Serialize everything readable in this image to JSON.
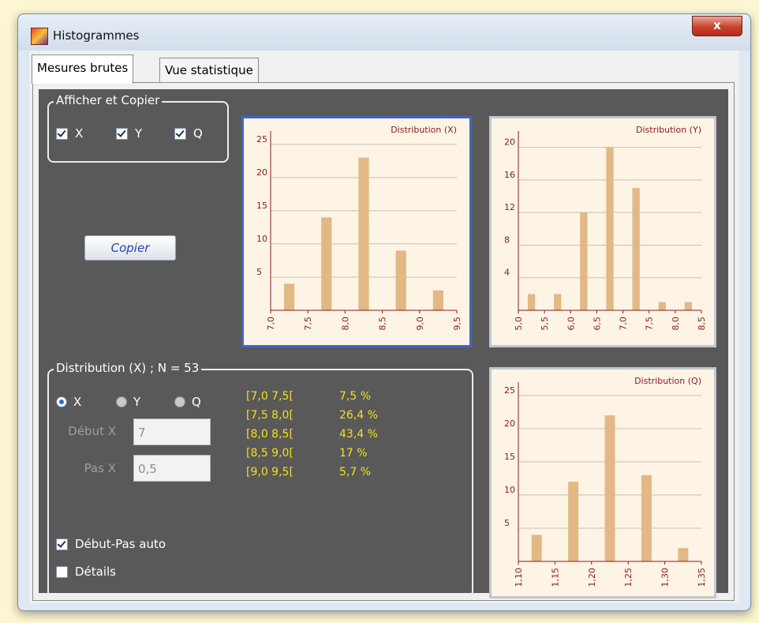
{
  "window": {
    "title": "Histogrammes",
    "close_glyph": "x"
  },
  "tabs": [
    {
      "label": "Mesures brutes"
    },
    {
      "label": "Vue statistique"
    }
  ],
  "display_group": {
    "title": "Afficher et Copier",
    "checkboxes": [
      {
        "label": "X",
        "checked": true
      },
      {
        "label": "Y",
        "checked": true
      },
      {
        "label": "Q",
        "checked": true
      }
    ],
    "copy_button": "Copier"
  },
  "distribution_group": {
    "title": "Distribution (X) ; N = 53",
    "radios": [
      {
        "label": "X",
        "selected": true
      },
      {
        "label": "Y",
        "selected": false
      },
      {
        "label": "Q",
        "selected": false
      }
    ],
    "start_label": "Début X",
    "start_value": "7",
    "step_label": "Pas X",
    "step_value": "0,5",
    "auto_checkbox": "Début-Pas auto",
    "details_checkbox": "Détails",
    "stats": [
      {
        "interval": "[7,0  7,5[",
        "percent": "7,5 %"
      },
      {
        "interval": "[7,5  8,0[",
        "percent": "26,4 %"
      },
      {
        "interval": "[8,0  8,5[",
        "percent": "43,4 %"
      },
      {
        "interval": "[8,5  9,0[",
        "percent": "17 %"
      },
      {
        "interval": "[9,0  9,5[",
        "percent": "5,7 %"
      }
    ]
  },
  "colors": {
    "bar": "#e2b884",
    "axis": "#8b1a1a",
    "chart_bg": "#fdf4e5",
    "stats_text": "#f5e01a",
    "panel_bg": "#595959"
  },
  "chart_data": [
    {
      "type": "bar",
      "title": "Distribution (X)",
      "x_ticks": [
        "7,0",
        "7,5",
        "8,0",
        "8,5",
        "9,0",
        "9,5"
      ],
      "x": [
        7.25,
        7.75,
        8.25,
        8.75,
        9.25
      ],
      "values": [
        4,
        14,
        23,
        9,
        3
      ],
      "xlim": [
        7.0,
        9.5
      ],
      "ylim": [
        0,
        27
      ],
      "y_ticks": [
        5,
        10,
        15,
        20,
        25
      ]
    },
    {
      "type": "bar",
      "title": "Distribution (Y)",
      "x_ticks": [
        "5,0",
        "5,5",
        "6,0",
        "6,5",
        "7,0",
        "7,5",
        "8,0",
        "8,5"
      ],
      "x": [
        5.25,
        5.75,
        6.25,
        6.75,
        7.25,
        7.75,
        8.25
      ],
      "values": [
        2,
        2,
        12,
        20,
        15,
        1,
        1
      ],
      "xlim": [
        5.0,
        8.5
      ],
      "ylim": [
        0,
        22
      ],
      "y_ticks": [
        4,
        8,
        12,
        16,
        20
      ]
    },
    {
      "type": "bar",
      "title": "Distribution (Q)",
      "x_ticks": [
        "1,10",
        "1,15",
        "1,20",
        "1,25",
        "1,30",
        "1,35"
      ],
      "x": [
        1.125,
        1.175,
        1.225,
        1.275,
        1.325
      ],
      "values": [
        4,
        12,
        22,
        13,
        2
      ],
      "xlim": [
        1.1,
        1.35
      ],
      "ylim": [
        0,
        27
      ],
      "y_ticks": [
        5,
        10,
        15,
        20,
        25
      ]
    }
  ]
}
